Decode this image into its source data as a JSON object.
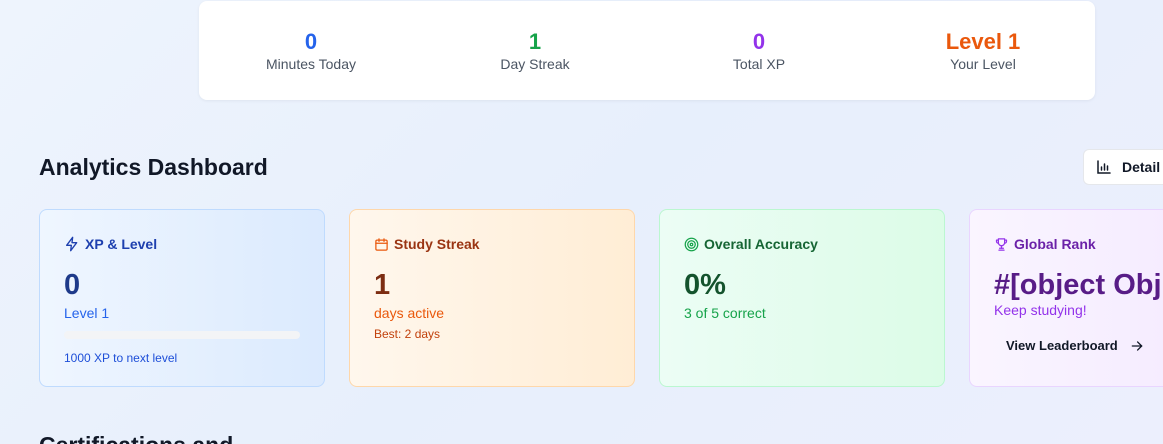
{
  "stats": [
    {
      "value": "0",
      "label": "Minutes Today",
      "color": "#2563eb"
    },
    {
      "value": "1",
      "label": "Day Streak",
      "color": "#16a34a"
    },
    {
      "value": "0",
      "label": "Total XP",
      "color": "#9333ea"
    },
    {
      "value": "Level 1",
      "label": "Your Level",
      "color": "#ea580c"
    }
  ],
  "dashboard": {
    "title": "Analytics Dashboard",
    "details_label": "Detail"
  },
  "cards": {
    "xp": {
      "title": "XP & Level",
      "value": "0",
      "level": "Level 1",
      "progress": 0,
      "note": "1000 XP to next level",
      "icon": "lightning-icon"
    },
    "streak": {
      "title": "Study Streak",
      "value": "1",
      "sub": "days active",
      "note": "Best: 2 days",
      "icon": "calendar-icon"
    },
    "accuracy": {
      "title": "Overall Accuracy",
      "value": "0%",
      "sub": "3 of 5 correct",
      "icon": "target-icon"
    },
    "rank": {
      "title": "Global Rank",
      "value": "#[object Obj",
      "sub": "Keep studying!",
      "button_label": "View Leaderboard",
      "icon": "trophy-icon"
    }
  },
  "next_section": {
    "heading": "Certifications and"
  }
}
